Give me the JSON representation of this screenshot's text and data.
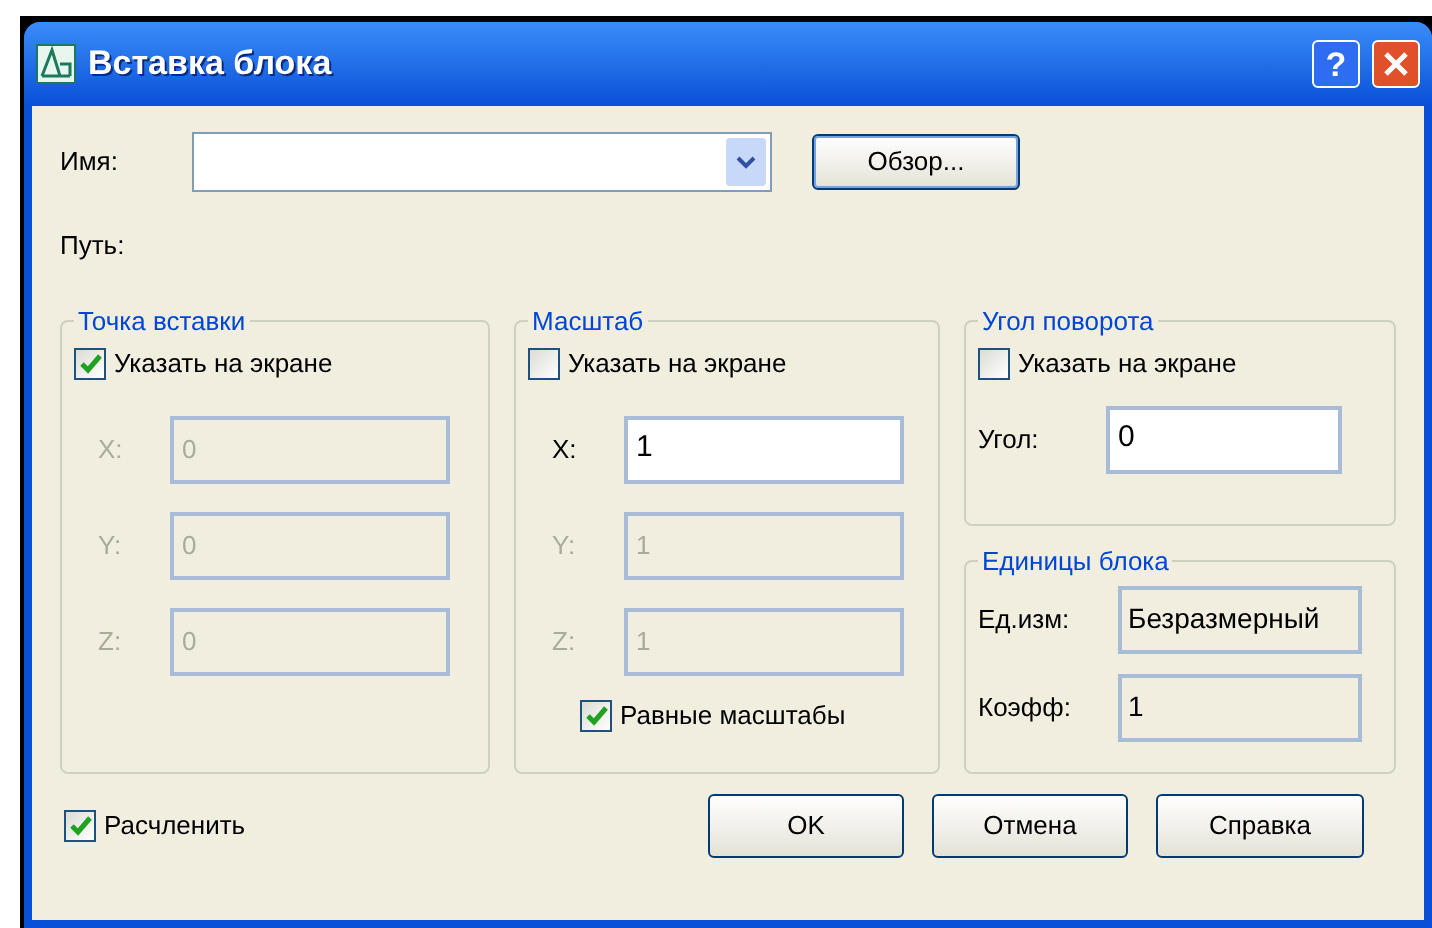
{
  "window": {
    "title": "Вставка блока",
    "help_button": "?"
  },
  "name_field": {
    "label": "Имя:"
  },
  "browse_button": "Обзор...",
  "path": {
    "label": "Путь:"
  },
  "insertion_point": {
    "title": "Точка вставки",
    "specify_on_screen": {
      "label": "Указать на экране",
      "checked": true
    },
    "fields": [
      {
        "label": "X:",
        "value": "0",
        "disabled": true
      },
      {
        "label": "Y:",
        "value": "0",
        "disabled": true
      },
      {
        "label": "Z:",
        "value": "0",
        "disabled": true
      }
    ]
  },
  "scale": {
    "title": "Масштаб",
    "specify_on_screen": {
      "label": "Указать на экране",
      "checked": false
    },
    "fields": [
      {
        "label": "X:",
        "value": "1",
        "disabled": false
      },
      {
        "label": "Y:",
        "value": "1",
        "disabled": true
      },
      {
        "label": "Z:",
        "value": "1",
        "disabled": true
      }
    ],
    "uniform_scale": {
      "label": "Равные масштабы",
      "checked": true
    }
  },
  "rotation": {
    "title": "Угол поворота",
    "specify_on_screen": {
      "label": "Указать на экране",
      "checked": false
    },
    "angle": {
      "label": "Угол:",
      "value": "0"
    }
  },
  "block_units": {
    "title": "Единицы блока",
    "unit": {
      "label": "Ед.изм:",
      "value": "Безразмерный"
    },
    "factor": {
      "label": "Коэфф:",
      "value": "1"
    }
  },
  "explode": {
    "label": "Расчленить",
    "checked": true
  },
  "buttons": [
    "OK",
    "Отмена",
    "Справка"
  ]
}
